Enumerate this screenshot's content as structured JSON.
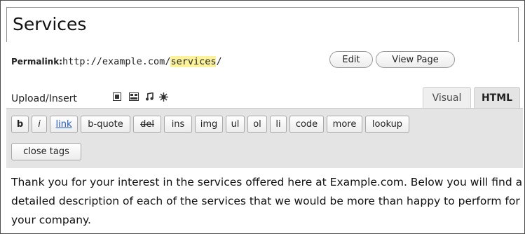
{
  "editor": {
    "title": "Services",
    "permalink": {
      "label": "Permalink:",
      "url_prefix": "http://example.com/",
      "slug": "services",
      "url_suffix": "/"
    },
    "buttons": {
      "edit": "Edit",
      "view_page": "View Page"
    },
    "upload_insert": {
      "label": "Upload/Insert",
      "icons": [
        "image-icon",
        "gallery-icon",
        "audio-icon",
        "media-icon"
      ]
    },
    "tabs": {
      "visual": "Visual",
      "html": "HTML",
      "active": "HTML"
    },
    "quicktags": {
      "row1": [
        "b",
        "i",
        "link",
        "b-quote",
        "del",
        "ins",
        "img",
        "ul",
        "ol",
        "li",
        "code",
        "more",
        "lookup"
      ],
      "row2": [
        "close tags"
      ]
    },
    "content": "Thank you for your interest in the services offered here at Example.com. Below you will find a detailed description of each of the services that we would be more than happy to perform for your company.",
    "colors": {
      "slug_highlight": "#fbf29a",
      "link": "#1e58c9",
      "toolbar_bg": "#e4e4e4"
    }
  }
}
